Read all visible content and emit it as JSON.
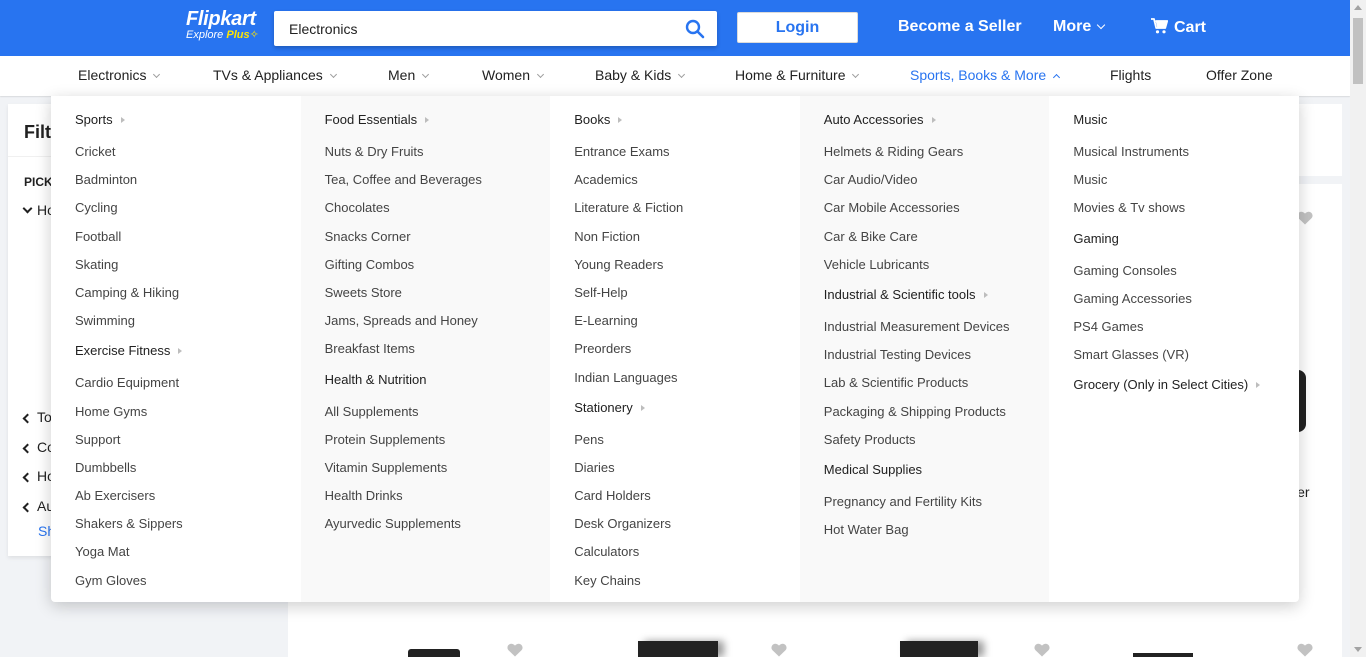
{
  "header": {
    "logo_brand": "Flipkart",
    "logo_explore": "Explore",
    "logo_plus": "Plus",
    "search_value": "Electronics",
    "login_label": "Login",
    "seller_label": "Become a Seller",
    "more_label": "More",
    "cart_label": "Cart",
    "colors": {
      "brand_blue": "#2874f0",
      "plus_yellow": "#ffe500"
    }
  },
  "nav": {
    "items": [
      {
        "label": "Electronics"
      },
      {
        "label": "TVs & Appliances"
      },
      {
        "label": "Men"
      },
      {
        "label": "Women"
      },
      {
        "label": "Baby & Kids"
      },
      {
        "label": "Home & Furniture"
      },
      {
        "label": "Sports, Books & More"
      },
      {
        "label": "Flights"
      },
      {
        "label": "Offer Zone"
      }
    ]
  },
  "filters": {
    "title": "Filt",
    "pick": "PICK",
    "rows": [
      "Ho",
      "To",
      "Co",
      "Ho",
      "Au"
    ],
    "show": "Sh"
  },
  "content": {
    "side_text": "ler"
  },
  "menu": {
    "col1": {
      "sports": "Sports",
      "sports_items": [
        "Cricket",
        "Badminton",
        "Cycling",
        "Football",
        "Skating",
        "Camping & Hiking",
        "Swimming"
      ],
      "fitness": "Exercise Fitness",
      "fitness_items": [
        "Cardio Equipment",
        "Home Gyms",
        "Support",
        "Dumbbells",
        "Ab Exercisers",
        "Shakers & Sippers",
        "Yoga Mat",
        "Gym Gloves"
      ]
    },
    "col2": {
      "food": "Food Essentials",
      "food_items": [
        "Nuts & Dry Fruits",
        "Tea, Coffee and Beverages",
        "Chocolates",
        "Snacks Corner",
        "Gifting Combos",
        "Sweets Store",
        "Jams, Spreads and Honey",
        "Breakfast Items"
      ],
      "health": "Health & Nutrition",
      "health_items": [
        "All Supplements",
        "Protein Supplements",
        "Vitamin Supplements",
        "Health Drinks",
        "Ayurvedic Supplements"
      ]
    },
    "col3": {
      "books": "Books",
      "books_items": [
        "Entrance Exams",
        "Academics",
        "Literature & Fiction",
        "Non Fiction",
        "Young Readers",
        "Self-Help",
        "E-Learning",
        "Preorders",
        "Indian Languages"
      ],
      "stationery": "Stationery",
      "stationery_items": [
        "Pens",
        "Diaries",
        "Card Holders",
        "Desk Organizers",
        "Calculators",
        "Key Chains"
      ]
    },
    "col4": {
      "auto": "Auto Accessories",
      "auto_items": [
        "Helmets & Riding Gears",
        "Car Audio/Video",
        "Car Mobile Accessories",
        "Car & Bike Care",
        "Vehicle Lubricants"
      ],
      "industrial": "Industrial & Scientific tools",
      "industrial_items": [
        "Industrial Measurement Devices",
        "Industrial Testing Devices",
        "Lab & Scientific Products",
        "Packaging & Shipping Products",
        "Safety Products"
      ],
      "medical": "Medical Supplies",
      "medical_items": [
        "Pregnancy and Fertility Kits",
        "Hot Water Bag"
      ]
    },
    "col5": {
      "music": "Music",
      "music_items": [
        "Musical Instruments",
        "Music",
        "Movies & Tv shows"
      ],
      "gaming": "Gaming",
      "gaming_items": [
        "Gaming Consoles",
        "Gaming Accessories",
        "PS4 Games",
        "Smart Glasses (VR)"
      ],
      "grocery": "Grocery (Only in Select Cities)"
    }
  }
}
